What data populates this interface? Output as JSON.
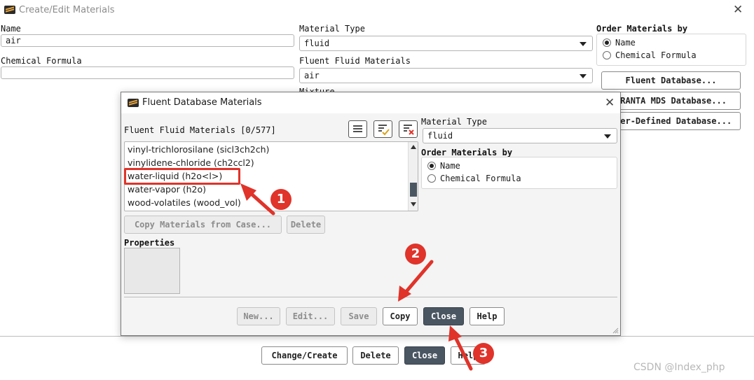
{
  "main_window": {
    "title": "Create/Edit Materials",
    "name_label": "Name",
    "name_value": "air",
    "chemical_formula_label": "Chemical Formula",
    "chemical_formula_value": "",
    "material_type_label": "Material Type",
    "material_type_value": "fluid",
    "fluent_fluid_materials_label": "Fluent Fluid Materials",
    "fluent_fluid_materials_value": "air",
    "mixture_label_partial": "Mixture",
    "order_by_label": "Order Materials by",
    "order_options": [
      {
        "label": "Name",
        "selected": true
      },
      {
        "label": "Chemical Formula",
        "selected": false
      }
    ],
    "db_buttons": [
      "Fluent Database...",
      "GRANTA MDS Database...",
      "User-Defined Database..."
    ],
    "bottom_buttons": {
      "change_create": "Change/Create",
      "delete": "Delete",
      "close": "Close",
      "help": "Help"
    }
  },
  "dialog": {
    "title": "Fluent Database Materials",
    "list_label": "Fluent Fluid Materials [0/577]",
    "materials": [
      "vinyl-trichlorosilane (sicl3ch2ch)",
      "vinylidene-chloride (ch2ccl2)",
      "water-liquid (h2o<l>)",
      "water-vapor (h2o)",
      "wood-volatiles (wood_vol)"
    ],
    "highlighted_index": 2,
    "copy_from_case": "Copy Materials from Case...",
    "delete": "Delete",
    "properties_label": "Properties",
    "material_type_label": "Material Type",
    "material_type_value": "fluid",
    "order_by_label": "Order Materials by",
    "order_options": [
      {
        "label": "Name",
        "selected": true
      },
      {
        "label": "Chemical Formula",
        "selected": false
      }
    ],
    "buttons": {
      "new": "New...",
      "edit": "Edit...",
      "save": "Save",
      "copy": "Copy",
      "close": "Close",
      "help": "Help"
    }
  },
  "annotations": [
    "1",
    "2",
    "3"
  ],
  "watermark": "CSDN @Index_php",
  "colors": {
    "annotation_red": "#e0332a",
    "primary_button": "#4a5662"
  }
}
